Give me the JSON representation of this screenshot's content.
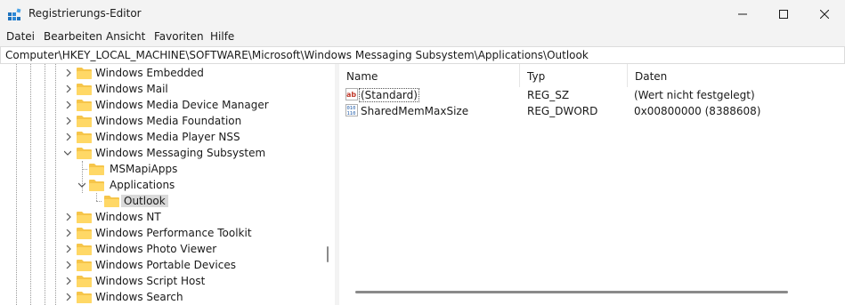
{
  "window": {
    "title": "Registrierungs-Editor",
    "controls": {
      "minimize": "minimize",
      "maximize": "maximize",
      "close": "close"
    }
  },
  "menu": [
    "Datei",
    "Bearbeiten",
    "Ansicht",
    "Favoriten",
    "Hilfe"
  ],
  "address": {
    "path": "Computer\\HKEY_LOCAL_MACHINE\\SOFTWARE\\Microsoft\\Windows Messaging Subsystem\\Applications\\Outlook"
  },
  "tree": {
    "items": [
      {
        "label": "Windows Embedded",
        "expanded": false
      },
      {
        "label": "Windows Mail",
        "expanded": false
      },
      {
        "label": "Windows Media Device Manager",
        "expanded": false
      },
      {
        "label": "Windows Media Foundation",
        "expanded": false
      },
      {
        "label": "Windows Media Player NSS",
        "expanded": false
      },
      {
        "label": "Windows Messaging Subsystem",
        "expanded": true
      },
      {
        "label": "MSMapiApps",
        "expanded": null
      },
      {
        "label": "Applications",
        "expanded": true
      },
      {
        "label": "Outlook",
        "expanded": null,
        "selected": true
      },
      {
        "label": "Windows NT",
        "expanded": false
      },
      {
        "label": "Windows Performance Toolkit",
        "expanded": false
      },
      {
        "label": "Windows Photo Viewer",
        "expanded": false
      },
      {
        "label": "Windows Portable Devices",
        "expanded": false
      },
      {
        "label": "Windows Script Host",
        "expanded": false
      },
      {
        "label": "Windows Search",
        "expanded": false
      }
    ]
  },
  "list": {
    "columns": [
      "Name",
      "Typ",
      "Daten"
    ],
    "rows": [
      {
        "icon": "string-value-icon",
        "name": "(Standard)",
        "type": "REG_SZ",
        "data": "(Wert nicht festgelegt)"
      },
      {
        "icon": "binary-value-icon",
        "name": "SharedMemMaxSize",
        "type": "REG_DWORD",
        "data": "0x00800000 (8388608)"
      }
    ]
  },
  "colors": {
    "folder": "#f6c54a",
    "selection": "#d9d9d9",
    "accent": "#0067c0"
  }
}
